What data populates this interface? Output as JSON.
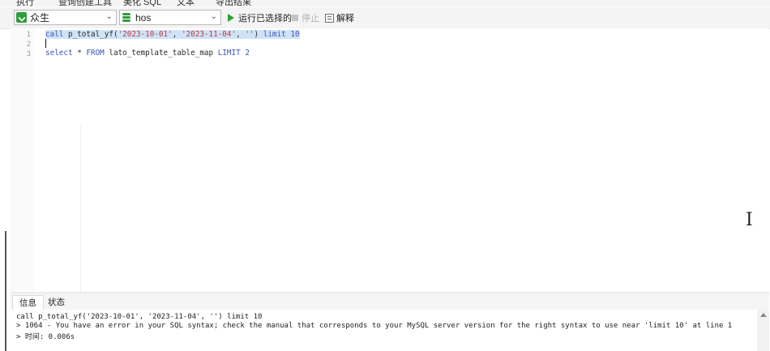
{
  "top_toolbar": {
    "items": [
      "执行",
      "查询创建工具",
      "美化 SQL",
      "文本",
      "导出结果"
    ]
  },
  "toolbar": {
    "connection": "众生",
    "database": "hos",
    "run_selected": "运行已选择的",
    "stop": "停止",
    "explain": "解释"
  },
  "editor": {
    "line_numbers": [
      "1",
      "2",
      "3"
    ],
    "line1": {
      "kw1": "call",
      "fn": " p_total_yf(",
      "str1": "'2023-10-01'",
      "sep1": ", ",
      "str2": "'2023-11-04'",
      "sep2": ", ",
      "str3": "''",
      "close": ") ",
      "kw2": "limit",
      "sp": " ",
      "num": "10"
    },
    "line3": {
      "kw1": "select",
      "mid": " * ",
      "kw2": "FROM",
      "table": " lato_template_table_map ",
      "kw3": "LIMIT",
      "sp": " ",
      "num": "2"
    }
  },
  "result_tabs": [
    "信息",
    "状态"
  ],
  "messages": [
    "call p_total_yf('2023-10-01', '2023-11-04', '') limit 10",
    "> 1064 - You have an error in your SQL syntax; check the manual that corresponds to your MySQL server version for the right syntax to use near 'limit 10' at line 1",
    "> 时间: 0.006s"
  ],
  "colors": {
    "keyword": "#3d54b8",
    "string": "#c03a3a",
    "selection": "#cfe3f8",
    "run_icon": "#2aa52f"
  }
}
